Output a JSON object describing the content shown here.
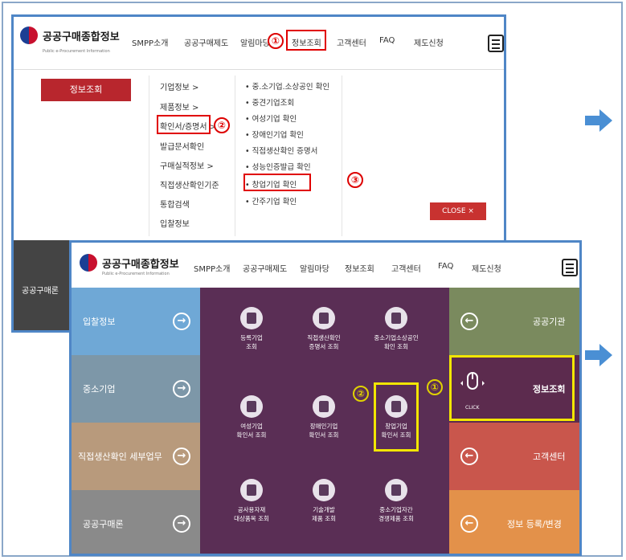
{
  "logo": {
    "title": "공공구매종합정보",
    "subtitle": "Public e-Procurement Information"
  },
  "nav": {
    "smpp": "SMPP소개",
    "system": "공공구매제도",
    "notice_short": "알림마당",
    "notice": "알림마당",
    "info": "정보조회",
    "support": "고객센터",
    "faq": "FAQ",
    "proposal": "제도신청"
  },
  "markers": {
    "one": "①",
    "two": "②",
    "three": "③"
  },
  "dropdown": {
    "button": "정보조회",
    "menu": [
      "기업정보 >",
      "제품정보 >",
      "확인서/증명서 >",
      "발급문서확인",
      "구매실적정보 >",
      "직접생산확인기준",
      "통합검색",
      "입찰정보"
    ],
    "sub": [
      "• 중.소기업.소상공인 확인",
      "• 중견기업조회",
      "• 여성기업 확인",
      "• 장애인기업 확인",
      "• 직접생산확인 증명서",
      "• 성능인증발급 확인",
      "• 창업기업 확인",
      "• 간주기업 확인"
    ],
    "close": "CLOSE ×"
  },
  "peek": {
    "left_text": "공공구매론"
  },
  "left_col": [
    {
      "label": "입찰정보",
      "color": "#6fa8d6"
    },
    {
      "label": "중소기업",
      "color": "#7d97a8"
    },
    {
      "label": "직접생산확인 세부업무",
      "color": "#b89a7c"
    },
    {
      "label": "공공구매론",
      "color": "#8a8a8a"
    }
  ],
  "tiles": [
    {
      "label": "등록기업\n조회"
    },
    {
      "label": "직접생산확인\n증명서 조회"
    },
    {
      "label": "중소기업소상공인\n확인 조회"
    },
    {
      "label": "여성기업\n확인서 조회"
    },
    {
      "label": "장애인기업\n확인서 조회"
    },
    {
      "label": "창업기업\n확인서 조회"
    },
    {
      "label": "공사용자재\n대상품목 조회"
    },
    {
      "label": "기술개발\n제품 조회"
    },
    {
      "label": "중소기업자간\n경쟁제품 조회"
    }
  ],
  "right_col": [
    {
      "label": "공공기관",
      "color": "#7a8a5e"
    },
    {
      "label": "정보조회",
      "color": "#5c2b4e"
    },
    {
      "label": "고객센터",
      "color": "#c9564c"
    },
    {
      "label": "정보 등록/변경",
      "color": "#e3914a"
    }
  ],
  "click_label": "CLICK",
  "colors": {
    "purple": "#5a2e55",
    "accent_red": "#e00000",
    "highlight_yellow": "#f2e600",
    "arrow_blue": "#4a8fd4"
  }
}
